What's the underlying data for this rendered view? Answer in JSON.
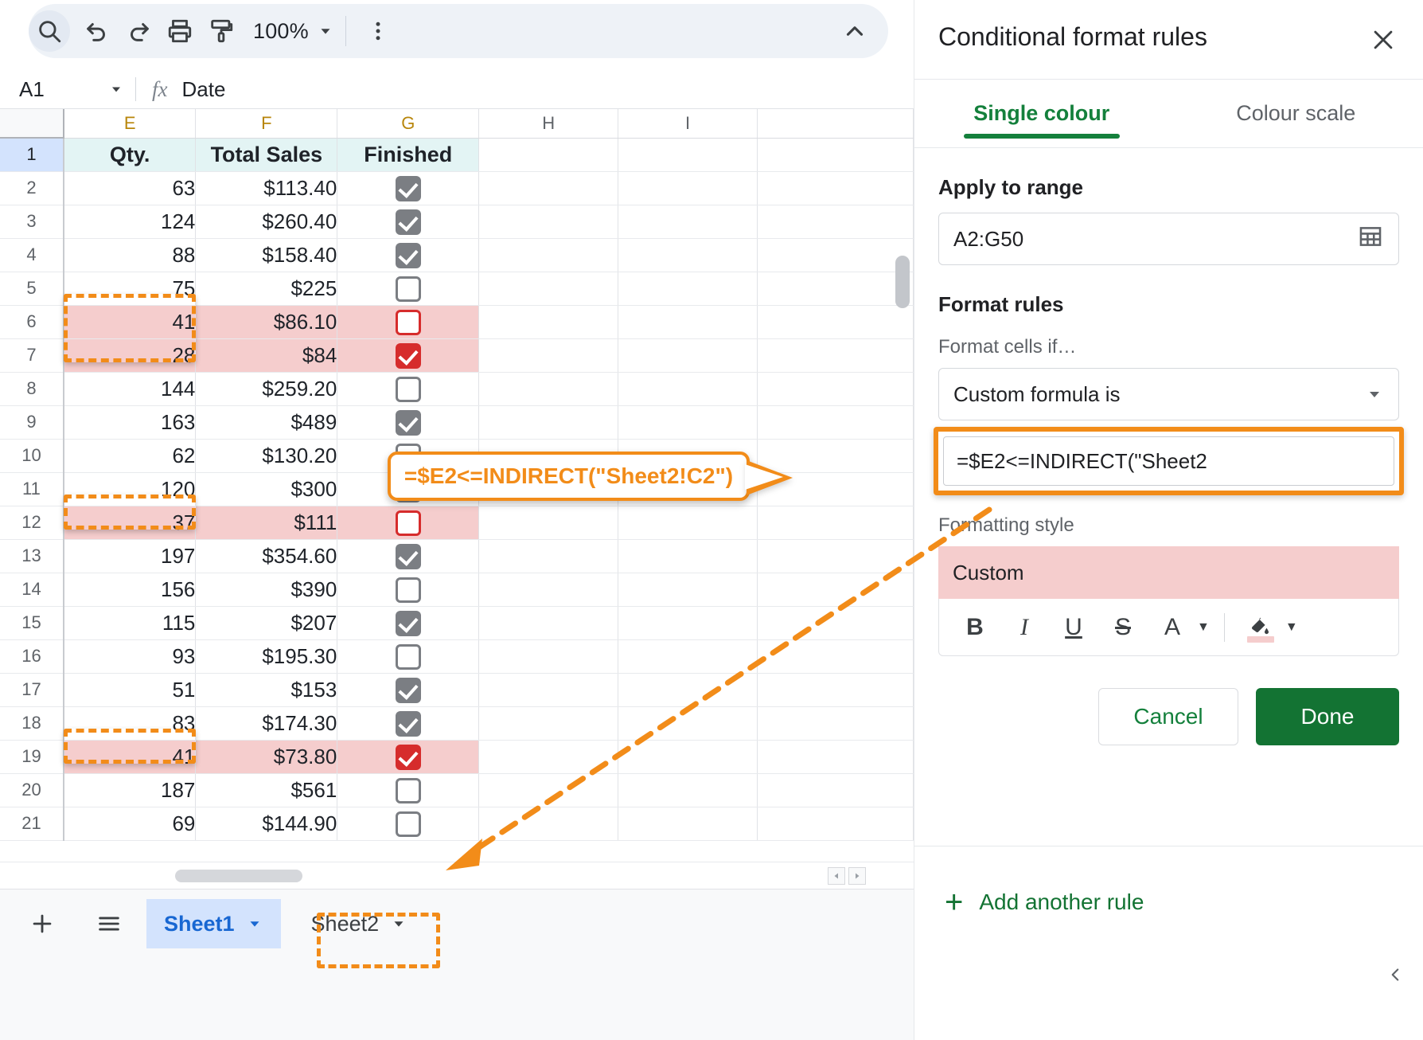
{
  "toolbar": {
    "zoom_level": "100%",
    "icons": [
      "search-icon",
      "undo-icon",
      "redo-icon",
      "print-icon",
      "paint-format-icon",
      "more-options-icon",
      "collapse-toolbar-icon"
    ]
  },
  "formula_bar": {
    "name_box": "A1",
    "fx_label": "fx",
    "cell_value": "Date"
  },
  "grid": {
    "columns": [
      "E",
      "F",
      "G",
      "H",
      "I"
    ],
    "headers": {
      "E": "Qty.",
      "F": "Total Sales",
      "G": "Finished"
    },
    "rows": [
      {
        "n": "1",
        "qty": "Qty.",
        "sales": "Total Sales",
        "checked": null,
        "header": true,
        "highlight": false,
        "redmark": false,
        "selected": false
      },
      {
        "n": "2",
        "qty": "63",
        "sales": "$113.40",
        "checked": true,
        "header": false,
        "highlight": false,
        "redmark": false,
        "selected": false
      },
      {
        "n": "3",
        "qty": "124",
        "sales": "$260.40",
        "checked": true,
        "header": false,
        "highlight": false,
        "redmark": false,
        "selected": false
      },
      {
        "n": "4",
        "qty": "88",
        "sales": "$158.40",
        "checked": true,
        "header": false,
        "highlight": false,
        "redmark": false,
        "selected": false
      },
      {
        "n": "5",
        "qty": "75",
        "sales": "$225",
        "checked": false,
        "header": false,
        "highlight": false,
        "redmark": false,
        "selected": false
      },
      {
        "n": "6",
        "qty": "41",
        "sales": "$86.10",
        "checked": false,
        "header": false,
        "highlight": true,
        "redmark": true,
        "selected": true
      },
      {
        "n": "7",
        "qty": "28",
        "sales": "$84",
        "checked": true,
        "header": false,
        "highlight": true,
        "redmark": true,
        "selected": true
      },
      {
        "n": "8",
        "qty": "144",
        "sales": "$259.20",
        "checked": false,
        "header": false,
        "highlight": false,
        "redmark": false,
        "selected": false
      },
      {
        "n": "9",
        "qty": "163",
        "sales": "$489",
        "checked": true,
        "header": false,
        "highlight": false,
        "redmark": false,
        "selected": false
      },
      {
        "n": "10",
        "qty": "62",
        "sales": "$130.20",
        "checked": false,
        "header": false,
        "highlight": false,
        "redmark": false,
        "selected": false
      },
      {
        "n": "11",
        "qty": "120",
        "sales": "$300",
        "checked": false,
        "header": false,
        "highlight": false,
        "redmark": false,
        "selected": false
      },
      {
        "n": "12",
        "qty": "37",
        "sales": "$111",
        "checked": false,
        "header": false,
        "highlight": true,
        "redmark": true,
        "selected": true
      },
      {
        "n": "13",
        "qty": "197",
        "sales": "$354.60",
        "checked": true,
        "header": false,
        "highlight": false,
        "redmark": false,
        "selected": false
      },
      {
        "n": "14",
        "qty": "156",
        "sales": "$390",
        "checked": false,
        "header": false,
        "highlight": false,
        "redmark": false,
        "selected": false
      },
      {
        "n": "15",
        "qty": "115",
        "sales": "$207",
        "checked": true,
        "header": false,
        "highlight": false,
        "redmark": false,
        "selected": false
      },
      {
        "n": "16",
        "qty": "93",
        "sales": "$195.30",
        "checked": false,
        "header": false,
        "highlight": false,
        "redmark": false,
        "selected": false
      },
      {
        "n": "17",
        "qty": "51",
        "sales": "$153",
        "checked": true,
        "header": false,
        "highlight": false,
        "redmark": false,
        "selected": false
      },
      {
        "n": "18",
        "qty": "83",
        "sales": "$174.30",
        "checked": true,
        "header": false,
        "highlight": false,
        "redmark": false,
        "selected": false
      },
      {
        "n": "19",
        "qty": "41",
        "sales": "$73.80",
        "checked": true,
        "header": false,
        "highlight": true,
        "redmark": true,
        "selected": true
      },
      {
        "n": "20",
        "qty": "187",
        "sales": "$561",
        "checked": false,
        "header": false,
        "highlight": false,
        "redmark": false,
        "selected": false
      },
      {
        "n": "21",
        "qty": "69",
        "sales": "$144.90",
        "checked": false,
        "header": false,
        "highlight": false,
        "redmark": false,
        "selected": false
      }
    ]
  },
  "sheet_tabs": {
    "add_label": "+",
    "all_sheets_label": "all-sheets-menu",
    "tabs": [
      {
        "name": "Sheet1",
        "active": true
      },
      {
        "name": "Sheet2",
        "active": false
      }
    ]
  },
  "panel": {
    "title": "Conditional format rules",
    "close_icon": "close-icon",
    "tabs": [
      {
        "label": "Single colour",
        "active": true
      },
      {
        "label": "Colour scale",
        "active": false
      }
    ],
    "apply_to_range": {
      "label": "Apply to range",
      "value": "A2:G50",
      "picker_icon": "range-picker-icon"
    },
    "format_rules": {
      "label": "Format rules",
      "condition_label": "Format cells if…",
      "condition_value": "Custom formula is",
      "formula_value": "=$E2<=INDIRECT(\"Sheet2"
    },
    "formatting_style": {
      "label": "Formatting style",
      "preview_text": "Custom",
      "preview_bg": "#f5cdcd",
      "tools": [
        "B",
        "I",
        "U",
        "S",
        "A"
      ],
      "fill_icon": "fill-colour-icon",
      "fill_swatch": "#f5cdcd"
    },
    "buttons": {
      "cancel": "Cancel",
      "done": "Done",
      "done_bg": "#137333"
    },
    "add_another_rule": "Add another rule",
    "collapse_icon": "panel-collapse-icon"
  },
  "annotation": {
    "callout_text": "=$E2<=INDIRECT(\"Sheet2!C2\")",
    "accent_colour": "#f28c19"
  }
}
